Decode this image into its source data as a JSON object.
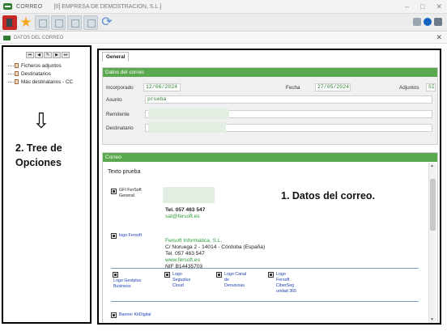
{
  "window": {
    "app_title": "CORREO",
    "company": "[0] EMPRESA DE DEMOSTRACION, S.L.]"
  },
  "subwindow": {
    "title": "DATOS DEL CORREO"
  },
  "left_panel": {
    "nav_buttons": [
      "⏮",
      "◀",
      "✎",
      "▶",
      "⏭"
    ],
    "tree_items": [
      {
        "label": "Ficheros adjuntos"
      },
      {
        "label": "Destinatarios"
      },
      {
        "label": "Más destinatarios - CC"
      }
    ],
    "caption_line1": "2. Tree de",
    "caption_line2": "Opciones"
  },
  "right_panel": {
    "tab_label": "General",
    "datos_section": {
      "title": "Datos del correo",
      "incorporado_label": "Incorporado",
      "incorporado_value": "12/06/2024",
      "fecha_label": "Fecha",
      "fecha_value": "27/05/2024",
      "adjuntos_label": "Adjuntos",
      "adjuntos_value": "SI",
      "asunto_label": "Asunto",
      "asunto_value": "prueba",
      "remitente_label": "Remitente",
      "destinatario_label": "Destinatario"
    },
    "correo_section": {
      "title": "Correo",
      "body_text": "Texto prueba",
      "img1_label_line1": "GFI FerSoft",
      "img1_label_line2": "General",
      "tel1": "Tel. 057 463 547",
      "email1": "sat@fersoft.es",
      "logo_label": "logo Fersoft",
      "company_name": "Fersoft Informática, S.L.",
      "address": "C/ Noruega 2 - 14014 - Córdoba (España)",
      "tel2": "Tel. 057 463 547",
      "web": "www.fersoft.es",
      "nif": "NIF B14435703",
      "logos": [
        "Logo Gestplus Business",
        "Logo Seguplus Cloud",
        "Logo Canal de Denuncias",
        "Logo Fersoft CiberSeg uridad 365"
      ],
      "banner_label": "Banner KitDigital"
    },
    "caption": "1. Datos del correo."
  },
  "colors": {
    "section_header": "#5aa84f",
    "field_text": "#2e7d32",
    "link_blue": "#1a3fb0"
  }
}
